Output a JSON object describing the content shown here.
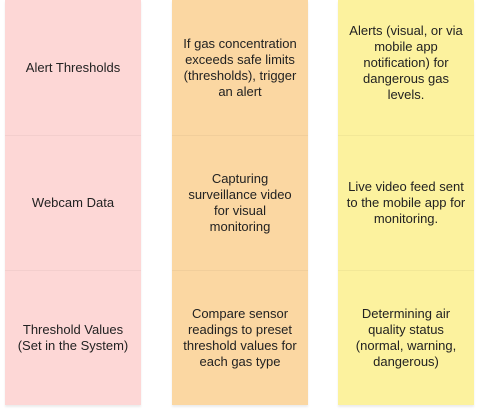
{
  "columns": [
    {
      "color": "#fdd7d6",
      "notes": [
        "Alert Thresholds",
        "Webcam Data",
        "Threshold Values (Set in the System)"
      ]
    },
    {
      "color": "#fbd7a2",
      "notes": [
        "If gas concentration exceeds safe limits (thresholds), trigger an alert",
        "Capturing surveillance video for visual monitoring",
        "Compare sensor readings to preset threshold values for each gas type"
      ]
    },
    {
      "color": "#fcf29e",
      "notes": [
        "Alerts (visual, or via mobile app notification) for dangerous gas levels.",
        "Live video feed sent to the mobile app for monitoring.",
        "Determining air quality status (normal, warning, dangerous)"
      ]
    }
  ]
}
